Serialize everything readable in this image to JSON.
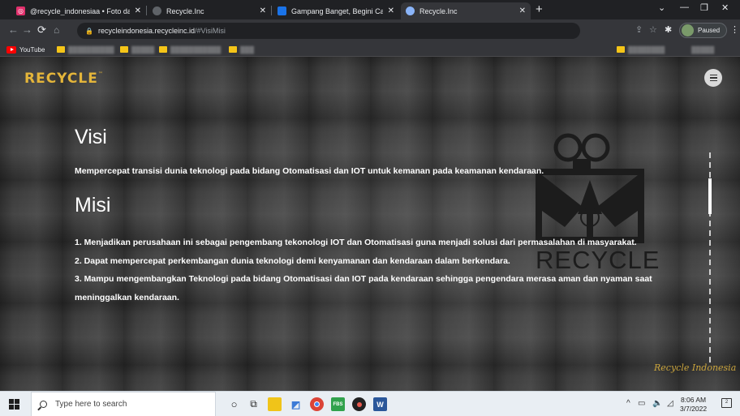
{
  "tabs": [
    {
      "title": "@recycle_indonesiaa • Foto dan",
      "favicon": "instagram-icon",
      "color": "#e1306c",
      "active": false
    },
    {
      "title": "Recycle.Inc",
      "favicon": "globe-icon",
      "color": "#5f6368",
      "active": false
    },
    {
      "title": "Gampang Banget, Begini Cara M",
      "favicon": "article-icon",
      "color": "#1a73e8",
      "active": false
    },
    {
      "title": "Recycle.Inc",
      "favicon": "globe-icon",
      "color": "#5f6368",
      "active": true
    }
  ],
  "address": {
    "host": "recycleindonesia.recycleinc.id",
    "path": "/#VisiMisi"
  },
  "profile_label": "Paused",
  "bookmarks": {
    "youtube": "YouTube"
  },
  "site": {
    "brand": "RECYCLE",
    "brand_tm": "™",
    "logo_word": "RECYCLE",
    "visi_heading": "Visi",
    "visi_text": "Mempercepat transisi dunia teknologi pada bidang Otomatisasi dan IOT untuk kemanan pada keamanan kendaraan.",
    "misi_heading": "Misi",
    "misi_items": [
      "1. Menjadikan perusahaan ini sebagai pengembang tekonologi IOT dan Otomatisasi guna menjadi solusi dari permasalahan di masyarakat.",
      "2. Dapat mempercepat perkembangan dunia teknologi demi kenyamanan dan kendaraan dalam berkendara.",
      "3. Mampu mengembangkan Teknologi pada bidang Otomatisasi dan IOT pada kendaraan sehingga pengendara merasa aman dan nyaman saat meninggalkan kendaraan."
    ],
    "signature": "Recycle Indonesia"
  },
  "taskbar": {
    "search_placeholder": "Type here to search",
    "time": "8:06 AM",
    "date": "3/7/2022",
    "notification_count": "2"
  },
  "colors": {
    "brand": "#e4b53a",
    "page_bg": "#3b3b3b",
    "chrome_dark": "#202124"
  }
}
